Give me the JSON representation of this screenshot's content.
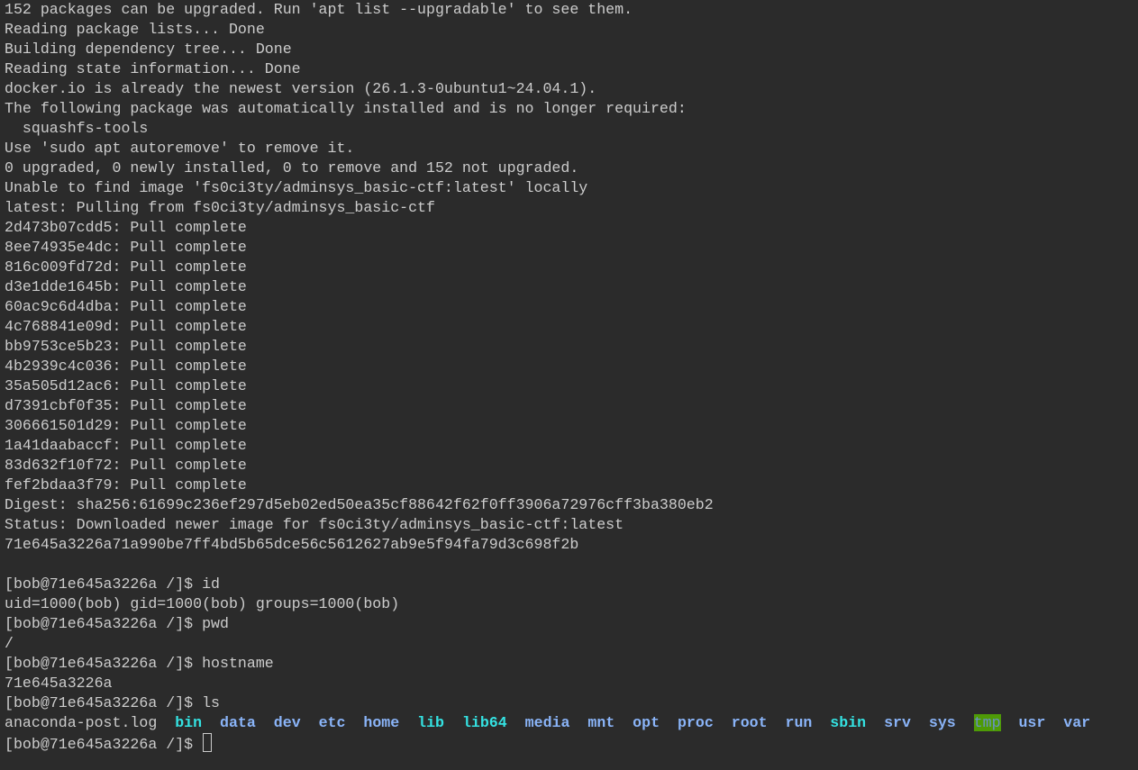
{
  "output_lines": [
    "152 packages can be upgraded. Run 'apt list --upgradable' to see them.",
    "Reading package lists... Done",
    "Building dependency tree... Done",
    "Reading state information... Done",
    "docker.io is already the newest version (26.1.3-0ubuntu1~24.04.1).",
    "The following package was automatically installed and is no longer required:",
    "  squashfs-tools",
    "Use 'sudo apt autoremove' to remove it.",
    "0 upgraded, 0 newly installed, 0 to remove and 152 not upgraded.",
    "Unable to find image 'fs0ci3ty/adminsys_basic-ctf:latest' locally",
    "latest: Pulling from fs0ci3ty/adminsys_basic-ctf",
    "2d473b07cdd5: Pull complete",
    "8ee74935e4dc: Pull complete",
    "816c009fd72d: Pull complete",
    "d3e1dde1645b: Pull complete",
    "60ac9c6d4dba: Pull complete",
    "4c768841e09d: Pull complete",
    "bb9753ce5b23: Pull complete",
    "4b2939c4c036: Pull complete",
    "35a505d12ac6: Pull complete",
    "d7391cbf0f35: Pull complete",
    "306661501d29: Pull complete",
    "1a41daabaccf: Pull complete",
    "83d632f10f72: Pull complete",
    "fef2bdaa3f79: Pull complete",
    "Digest: sha256:61699c236ef297d5eb02ed50ea35cf88642f62f0ff3906a72976cff3ba380eb2",
    "Status: Downloaded newer image for fs0ci3ty/adminsys_basic-ctf:latest",
    "71e645a3226a71a990be7ff4bd5b65dce56c5612627ab9e5f94fa79d3c698f2b",
    "",
    "[bob@71e645a3226a /]$ id",
    "uid=1000(bob) gid=1000(bob) groups=1000(bob)",
    "[bob@71e645a3226a /]$ pwd",
    "/",
    "[bob@71e645a3226a /]$ hostname",
    "71e645a3226a",
    "[bob@71e645a3226a /]$ ls"
  ],
  "ls_entries": [
    {
      "name": "anaconda-post.log",
      "type": "file"
    },
    {
      "name": "bin",
      "type": "link"
    },
    {
      "name": "data",
      "type": "dir"
    },
    {
      "name": "dev",
      "type": "dir"
    },
    {
      "name": "etc",
      "type": "dir"
    },
    {
      "name": "home",
      "type": "dir"
    },
    {
      "name": "lib",
      "type": "link"
    },
    {
      "name": "lib64",
      "type": "link"
    },
    {
      "name": "media",
      "type": "dir"
    },
    {
      "name": "mnt",
      "type": "dir"
    },
    {
      "name": "opt",
      "type": "dir"
    },
    {
      "name": "proc",
      "type": "dir"
    },
    {
      "name": "root",
      "type": "dir"
    },
    {
      "name": "run",
      "type": "dir"
    },
    {
      "name": "sbin",
      "type": "link"
    },
    {
      "name": "srv",
      "type": "dir"
    },
    {
      "name": "sys",
      "type": "dir"
    },
    {
      "name": "tmp",
      "type": "sticky"
    },
    {
      "name": "usr",
      "type": "dir"
    },
    {
      "name": "var",
      "type": "dir"
    }
  ],
  "prompt": "[bob@71e645a3226a /]$ ",
  "colors": {
    "background": "#2b2b2b",
    "foreground": "#cccccc",
    "directory": "#8ab4f8",
    "symlink": "#34e2e2",
    "sticky_bg": "#4e9a06"
  }
}
